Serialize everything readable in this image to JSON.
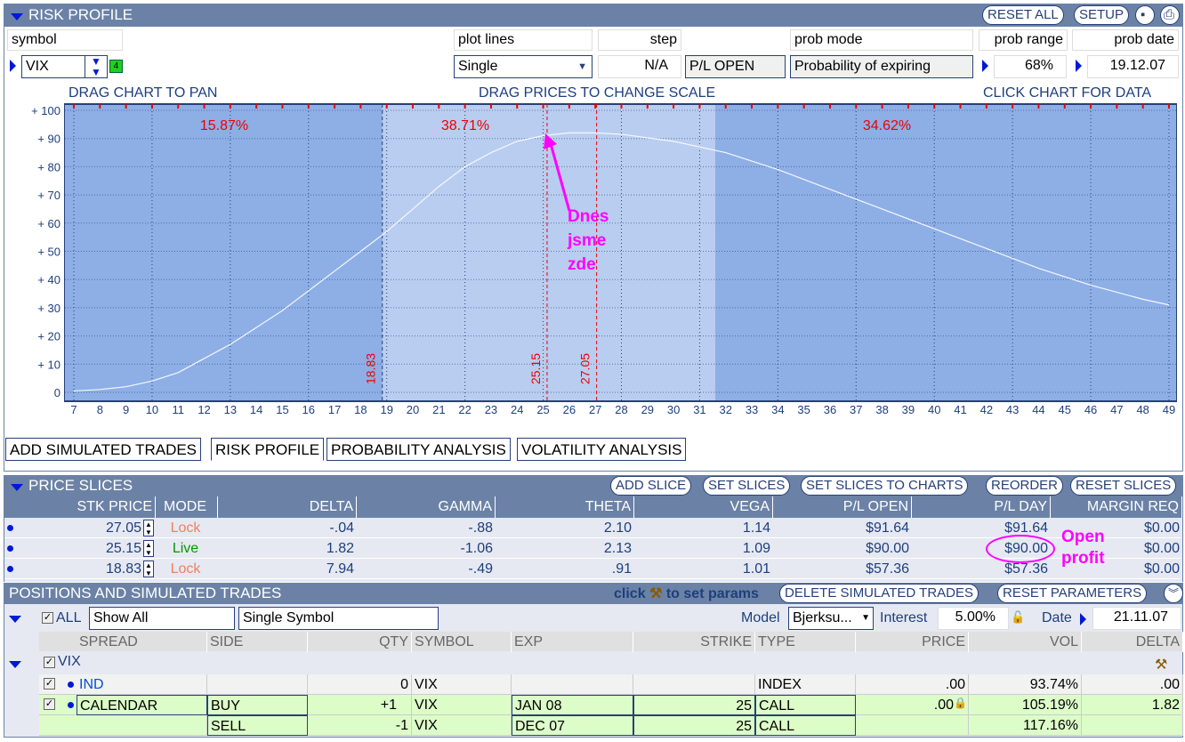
{
  "risk_profile": {
    "title": "RISK PROFILE",
    "buttons": {
      "reset_all": "RESET ALL",
      "setup": "SETUP"
    },
    "labels": {
      "symbol": "symbol",
      "plot_lines": "plot lines",
      "step": "step",
      "prob_mode": "prob mode",
      "prob_range": "prob range",
      "prob_date": "prob date"
    },
    "values": {
      "symbol": "VIX",
      "badge": "4",
      "plot_lines": "Single",
      "step": "N/A",
      "pl_mode": "P/L OPEN",
      "prob_mode": "Probability of expiring",
      "prob_range": "68%",
      "prob_date": "19.12.07"
    },
    "hints": {
      "pan": "DRAG CHART TO PAN",
      "scale": "DRAG PRICES TO CHANGE SCALE",
      "click": "CLICK CHART FOR DATA"
    }
  },
  "chart_data": {
    "type": "line",
    "x_range": [
      7,
      49
    ],
    "y_range": [
      0,
      100
    ],
    "xticks": [
      7,
      8,
      9,
      10,
      11,
      12,
      13,
      14,
      15,
      16,
      17,
      18,
      19,
      20,
      21,
      22,
      23,
      24,
      25,
      26,
      27,
      28,
      29,
      30,
      31,
      32,
      33,
      34,
      35,
      36,
      37,
      38,
      39,
      40,
      41,
      42,
      43,
      44,
      45,
      46,
      47,
      48,
      49
    ],
    "yticks": [
      {
        "v": 0,
        "t": "0"
      },
      {
        "v": 10,
        "t": "+ 10"
      },
      {
        "v": 20,
        "t": "+ 20"
      },
      {
        "v": 30,
        "t": "+ 30"
      },
      {
        "v": 40,
        "t": "+ 40"
      },
      {
        "v": 50,
        "t": "+ 50"
      },
      {
        "v": 60,
        "t": "+ 60"
      },
      {
        "v": 70,
        "t": "+ 70"
      },
      {
        "v": 80,
        "t": "+ 80"
      },
      {
        "v": 90,
        "t": "+ 90"
      },
      {
        "v": 100,
        "t": "+ 100"
      }
    ],
    "series": [
      {
        "name": "P/L OPEN",
        "x": [
          7,
          8,
          9,
          10,
          11,
          12,
          13,
          14,
          15,
          16,
          17,
          18,
          19,
          20,
          21,
          22,
          23,
          24,
          25,
          26,
          27,
          28,
          30,
          32,
          34,
          36,
          38,
          40,
          42,
          44,
          46,
          48,
          49
        ],
        "y": [
          0.5,
          1,
          2,
          4,
          7,
          12,
          17,
          23,
          29,
          36,
          43,
          50,
          57,
          65,
          73,
          80,
          85,
          89,
          91,
          92,
          92,
          91.5,
          89,
          85,
          79,
          72,
          65,
          58,
          51,
          44,
          38,
          33,
          31
        ]
      }
    ],
    "prob_regions": [
      {
        "from": 7,
        "to": 18.83,
        "label": "15.87%"
      },
      {
        "from": 18.83,
        "to": 31.6,
        "label": "38.71%"
      },
      {
        "from": 31.6,
        "to": 49,
        "label": "34.62%"
      }
    ],
    "price_lines": [
      {
        "x": 18.83,
        "label": "18.83"
      },
      {
        "x": 25.15,
        "label": "25.15"
      },
      {
        "x": 27.05,
        "label": "27.05"
      }
    ],
    "annotation": "Dnes jsme zde"
  },
  "tabs": [
    "ADD SIMULATED TRADES",
    "RISK PROFILE",
    "PROBABILITY ANALYSIS",
    "VOLATILITY ANALYSIS"
  ],
  "price_slices": {
    "title": "PRICE SLICES",
    "buttons": [
      "ADD SLICE",
      "SET SLICES",
      "SET SLICES TO CHARTS",
      "REORDER",
      "RESET SLICES"
    ],
    "columns": [
      "STK PRICE",
      "MODE",
      "DELTA",
      "GAMMA",
      "THETA",
      "VEGA",
      "P/L OPEN",
      "P/L DAY",
      "MARGIN REQ"
    ],
    "rows": [
      [
        "27.05",
        "Lock",
        "-.04",
        "-.88",
        "2.10",
        "1.14",
        "$91.64",
        "$91.64",
        "$0.00"
      ],
      [
        "25.15",
        "Live",
        "1.82",
        "-1.06",
        "2.13",
        "1.09",
        "$90.00",
        "$90.00",
        "$0.00"
      ],
      [
        "18.83",
        "Lock",
        "7.94",
        "-.49",
        ".91",
        "1.01",
        "$57.36",
        "$57.36",
        "$0.00"
      ]
    ],
    "annotation": "Open profit"
  },
  "positions": {
    "title": "POSITIONS AND SIMULATED TRADES",
    "hint_pre": "click",
    "hint_post": "to set params",
    "buttons": [
      "DELETE SIMULATED TRADES",
      "RESET PARAMETERS"
    ],
    "all_label": "ALL",
    "show": "Show All",
    "mode": "Single Symbol",
    "model_label": "Model",
    "model": "Bjerksu...",
    "interest_label": "Interest",
    "interest": "5.00%",
    "date_label": "Date",
    "date": "21.11.07",
    "columns": [
      "SPREAD",
      "SIDE",
      "QTY",
      "SYMBOL",
      "EXP",
      "STRIKE",
      "TYPE",
      "PRICE",
      "VOL",
      "DELTA"
    ],
    "group": "VIX",
    "rows": [
      [
        "IND",
        "",
        "0",
        "VIX",
        "",
        "",
        "INDEX",
        ".00",
        "93.74%",
        ".00"
      ],
      [
        "CALENDAR",
        "BUY",
        "+1",
        "VIX",
        "JAN 08",
        "25",
        "CALL",
        ".00",
        "105.19%",
        "1.82"
      ],
      [
        "",
        "SELL",
        "-1",
        "VIX",
        "DEC 07",
        "25",
        "CALL",
        "",
        "117.16%",
        ""
      ]
    ]
  }
}
